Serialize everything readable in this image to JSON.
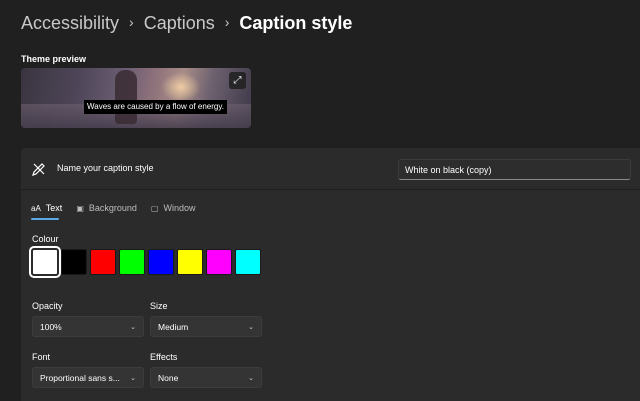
{
  "breadcrumb": {
    "items": [
      "Accessibility",
      "Captions",
      "Caption style"
    ]
  },
  "preview": {
    "label": "Theme preview",
    "caption": "Waves are caused by a flow of energy.",
    "expand_icon": "expand-icon"
  },
  "caption_style": {
    "name_label": "Name your caption style",
    "name_value": "White on black (copy)",
    "name_icon": "pen-edit-icon"
  },
  "tabs": [
    {
      "label": "Text",
      "icon": "aA",
      "active": true
    },
    {
      "label": "Background",
      "icon": "background-icon",
      "active": false
    },
    {
      "label": "Window",
      "icon": "window-icon",
      "active": false
    }
  ],
  "colour": {
    "label": "Colour",
    "swatches": [
      "#ffffff",
      "#000000",
      "#ff0000",
      "#00ff00",
      "#0000ff",
      "#ffff00",
      "#ff00ff",
      "#00ffff"
    ],
    "selected": "#ffffff"
  },
  "opacity": {
    "label": "Opacity",
    "value": "100%"
  },
  "size": {
    "label": "Size",
    "value": "Medium"
  },
  "font": {
    "label": "Font",
    "value": "Proportional sans s..."
  },
  "effects": {
    "label": "Effects",
    "value": "None"
  },
  "accent_color": "#5ba9e8"
}
